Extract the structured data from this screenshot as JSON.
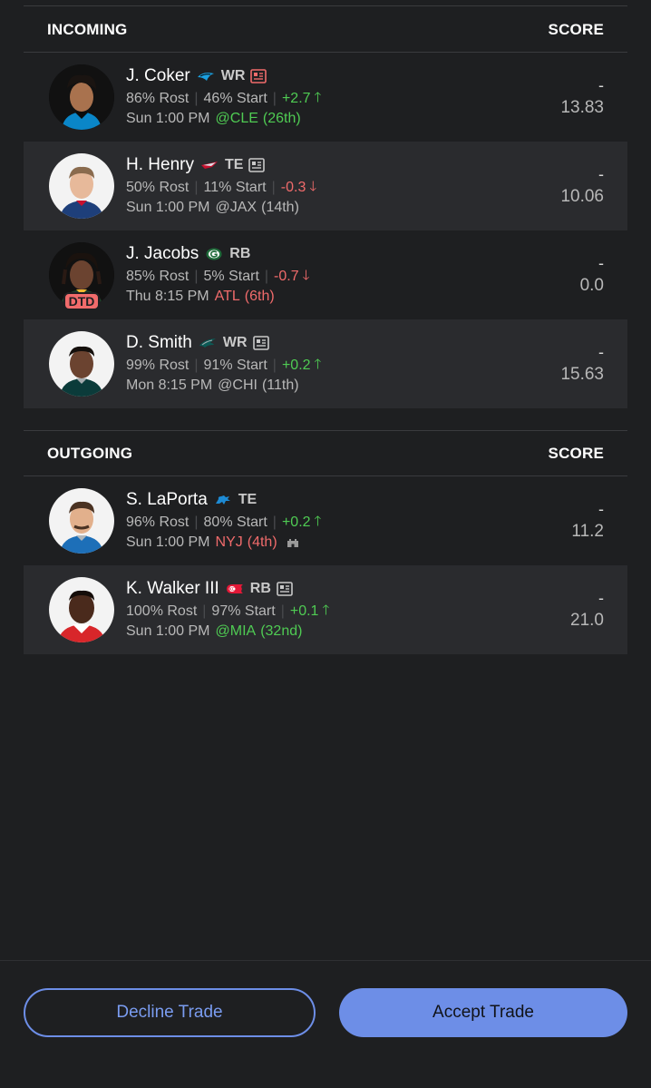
{
  "incoming": {
    "header": "INCOMING",
    "score_header": "SCORE",
    "players": [
      {
        "name": "J. Coker",
        "pos": "WR",
        "team_icon": "panthers-logo-icon",
        "rost": "86% Rost",
        "start": "46% Start",
        "trend": "+2.7",
        "trend_dir": "up",
        "day": "Sun",
        "time": "1:00 PM",
        "opp": "@CLE",
        "opp_rank": "(26th)",
        "opp_color": "good",
        "score_dash": "-",
        "score": "13.83",
        "status": ""
      },
      {
        "name": "H. Henry",
        "pos": "TE",
        "team_icon": "patriots-logo-icon",
        "rost": "50% Rost",
        "start": "11% Start",
        "trend": "-0.3",
        "trend_dir": "down",
        "day": "Sun",
        "time": "1:00 PM",
        "opp": "@JAX",
        "opp_rank": "(14th)",
        "opp_color": "neutral",
        "score_dash": "-",
        "score": "10.06",
        "status": ""
      },
      {
        "name": "J. Jacobs",
        "pos": "RB",
        "team_icon": "packers-logo-icon",
        "rost": "85% Rost",
        "start": "5% Start",
        "trend": "-0.7",
        "trend_dir": "down",
        "day": "Thu",
        "time": "8:15 PM",
        "opp": "ATL",
        "opp_rank": "(6th)",
        "opp_color": "bad",
        "score_dash": "-",
        "score": "0.0",
        "status": "DTD"
      },
      {
        "name": "D. Smith",
        "pos": "WR",
        "team_icon": "eagles-logo-icon",
        "rost": "99% Rost",
        "start": "91% Start",
        "trend": "+0.2",
        "trend_dir": "up",
        "day": "Mon",
        "time": "8:15 PM",
        "opp": "@CHI",
        "opp_rank": "(11th)",
        "opp_color": "neutral",
        "score_dash": "-",
        "score": "15.63",
        "status": ""
      }
    ]
  },
  "outgoing": {
    "header": "OUTGOING",
    "score_header": "SCORE",
    "players": [
      {
        "name": "S. LaPorta",
        "pos": "TE",
        "team_icon": "lions-logo-icon",
        "rost": "96% Rost",
        "start": "80% Start",
        "trend": "+0.2",
        "trend_dir": "up",
        "day": "Sun",
        "time": "1:00 PM",
        "opp": "NYJ",
        "opp_rank": "(4th)",
        "opp_color": "bad",
        "score_dash": "-",
        "score": "11.2",
        "status": ""
      },
      {
        "name": "K. Walker III",
        "pos": "RB",
        "team_icon": "chiefs-logo-icon",
        "rost": "100% Rost",
        "start": "97% Start",
        "trend": "+0.1",
        "trend_dir": "up",
        "day": "Sun",
        "time": "1:00 PM",
        "opp": "@MIA",
        "opp_rank": "(32nd)",
        "opp_color": "good",
        "score_dash": "-",
        "score": "21.0",
        "status": ""
      }
    ]
  },
  "buttons": {
    "decline": "Decline Trade",
    "accept": "Accept Trade"
  },
  "colors": {
    "background": "#1e1f21",
    "row_alt": "#2a2b2e",
    "positive": "#4fcb53",
    "negative": "#f06b6b",
    "accent": "#6d8ee7"
  }
}
